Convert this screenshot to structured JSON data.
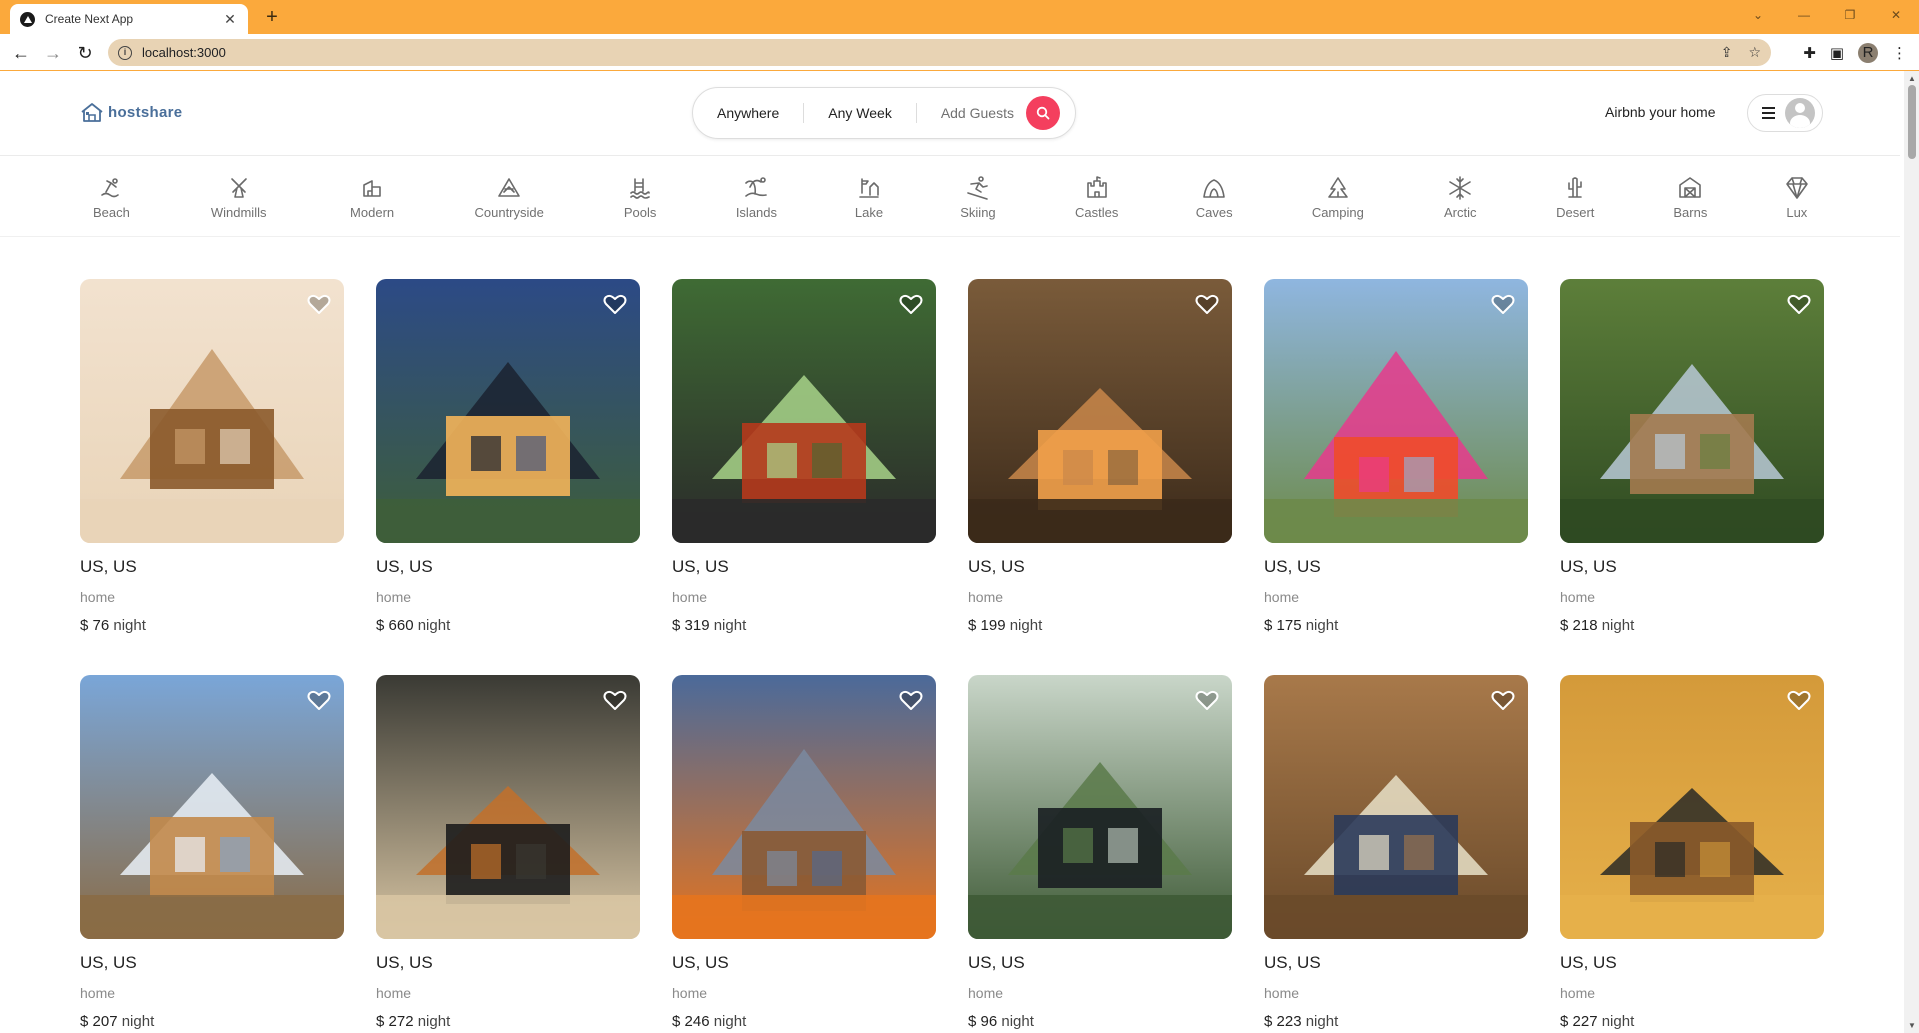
{
  "browser": {
    "tab_title": "Create Next App",
    "url": "localhost:3000",
    "profile_initial": "R",
    "theme_color": "#fba93c"
  },
  "header": {
    "logo_text": "hostshare",
    "search": {
      "where": "Anywhere",
      "when": "Any Week",
      "who": "Add Guests"
    },
    "host_link": "Airbnb your home",
    "accent": "#f43f5e"
  },
  "categories": [
    {
      "label": "Beach",
      "icon": "beach-icon"
    },
    {
      "label": "Windmills",
      "icon": "windmill-icon"
    },
    {
      "label": "Modern",
      "icon": "modern-icon"
    },
    {
      "label": "Countryside",
      "icon": "mountain-icon"
    },
    {
      "label": "Pools",
      "icon": "pool-icon"
    },
    {
      "label": "Islands",
      "icon": "island-icon"
    },
    {
      "label": "Lake",
      "icon": "lake-icon"
    },
    {
      "label": "Skiing",
      "icon": "skiing-icon"
    },
    {
      "label": "Castles",
      "icon": "castle-icon"
    },
    {
      "label": "Caves",
      "icon": "cave-icon"
    },
    {
      "label": "Camping",
      "icon": "camping-icon"
    },
    {
      "label": "Arctic",
      "icon": "snowflake-icon"
    },
    {
      "label": "Desert",
      "icon": "cactus-icon"
    },
    {
      "label": "Barns",
      "icon": "barn-icon"
    },
    {
      "label": "Lux",
      "icon": "diamond-icon"
    }
  ],
  "listings": [
    {
      "location": "US, US",
      "type": "home",
      "price": "$ 76",
      "unit": "night"
    },
    {
      "location": "US, US",
      "type": "home",
      "price": "$ 660",
      "unit": "night"
    },
    {
      "location": "US, US",
      "type": "home",
      "price": "$ 319",
      "unit": "night"
    },
    {
      "location": "US, US",
      "type": "home",
      "price": "$ 199",
      "unit": "night"
    },
    {
      "location": "US, US",
      "type": "home",
      "price": "$ 175",
      "unit": "night"
    },
    {
      "location": "US, US",
      "type": "home",
      "price": "$ 218",
      "unit": "night"
    },
    {
      "location": "US, US",
      "type": "home",
      "price": "$ 207",
      "unit": "night"
    },
    {
      "location": "US, US",
      "type": "home",
      "price": "$ 272",
      "unit": "night"
    },
    {
      "location": "US, US",
      "type": "home",
      "price": "$ 246",
      "unit": "night"
    },
    {
      "location": "US, US",
      "type": "home",
      "price": "$ 96",
      "unit": "night"
    },
    {
      "location": "US, US",
      "type": "home",
      "price": "$ 223",
      "unit": "night"
    },
    {
      "location": "US, US",
      "type": "home",
      "price": "$ 227",
      "unit": "night"
    }
  ]
}
